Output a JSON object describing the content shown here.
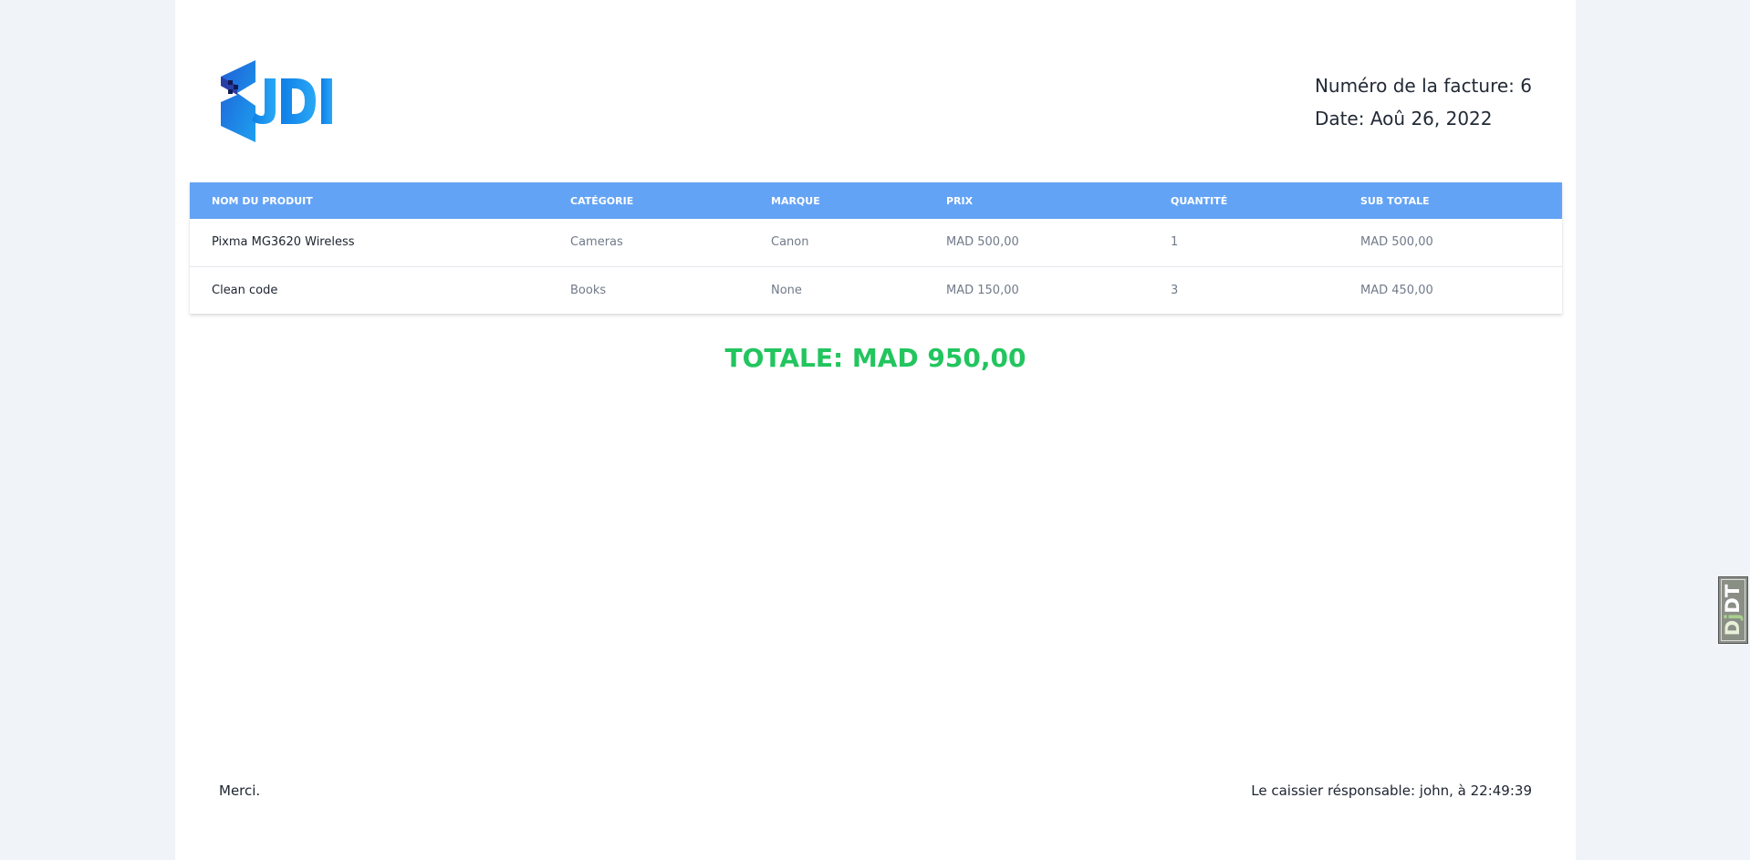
{
  "brand": {
    "logo_text": "JDI"
  },
  "invoice": {
    "number_label": "Numéro de la facture:",
    "number": "6",
    "date_label": "Date:",
    "date": "Aoû 26, 2022"
  },
  "table": {
    "headers": [
      "Nom du produit",
      "Catégorie",
      "Marque",
      "Prix",
      "Quantité",
      "Sub totale"
    ],
    "rows": [
      [
        "Pixma MG3620 Wireless",
        "Cameras",
        "Canon",
        "MAD 500,00",
        "1",
        "MAD 500,00"
      ],
      [
        "Clean code",
        "Books",
        "None",
        "MAD 150,00",
        "3",
        "MAD 450,00"
      ]
    ]
  },
  "total": {
    "label": "TOTALE: MAD 950,00"
  },
  "footer": {
    "thanks": "Merci.",
    "cashier": "Le caissier résponsable: john, à 22:49:39"
  },
  "debug_toolbar": {
    "label_d": "D",
    "label_j": "j",
    "label_dt": "DT"
  },
  "colors": {
    "header_bg": "#63a3f5",
    "total_green": "#22c55e",
    "page_bg": "#f0f3f8"
  },
  "icons": {
    "logo": "jdi-logo-icon"
  }
}
